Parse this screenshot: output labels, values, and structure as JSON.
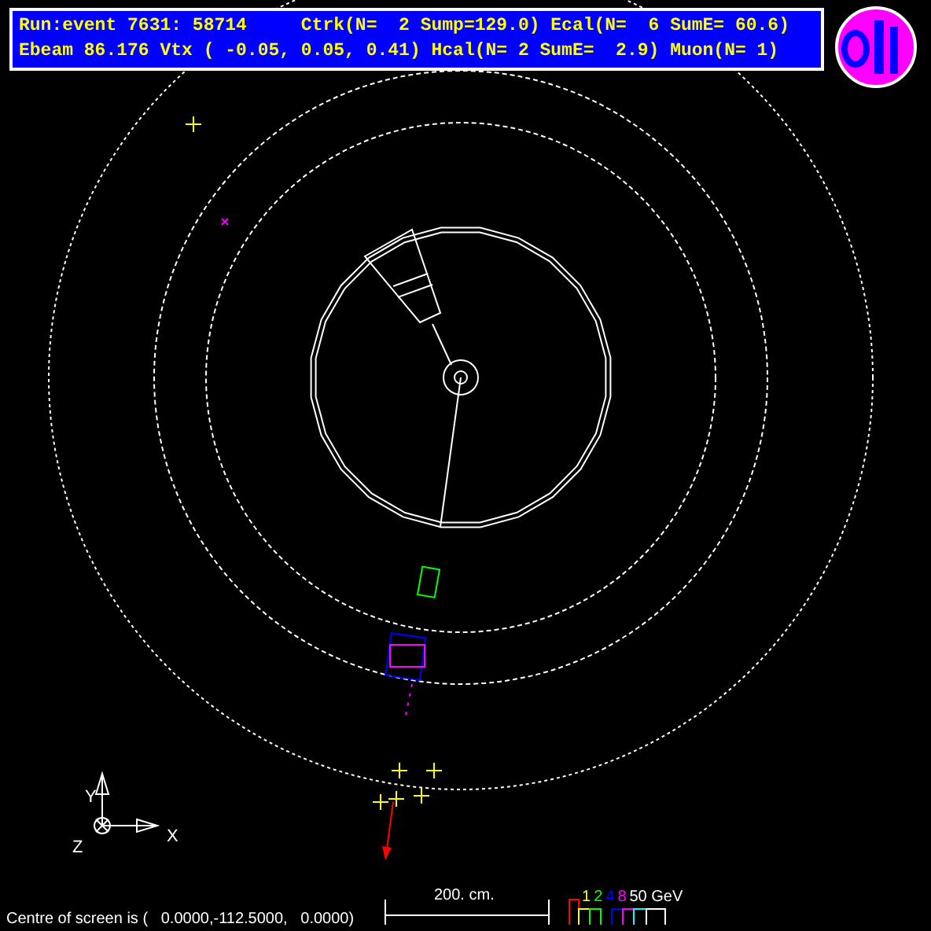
{
  "header": {
    "lines": [
      "Run:event 7631: 58714     Ctrk(N=  2 Sump=129.0) Ecal(N=  6 SumE= 60.6)",
      "Ebeam 86.176 Vtx ( -0.05, 0.05, 0.41) Hcal(N= 2 SumE=  2.9) Muon(N= 1)"
    ]
  },
  "axes": {
    "x": "X",
    "y": "Y",
    "z": "Z"
  },
  "scale": {
    "label": "200. cm."
  },
  "energy_legend": [
    {
      "label": "1",
      "color": "#ffff00"
    },
    {
      "label": "2",
      "color": "#00ff00"
    },
    {
      "label": "4",
      "color": "#0000ff"
    },
    {
      "label": "8",
      "color": "#ff00ff"
    },
    {
      "label": "50 GeV",
      "color": "#ffffff"
    }
  ],
  "footer": "Centre of screen is (   0.0000,-112.5000,   0.0000)"
}
